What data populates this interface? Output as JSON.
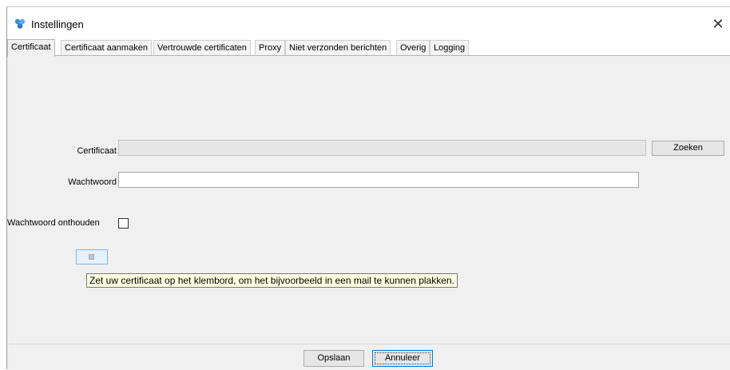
{
  "window": {
    "title": "Instellingen",
    "close_glyph": "✕"
  },
  "tabs": [
    {
      "label": "Certificaat",
      "active": true
    },
    {
      "label": "Certificaat aanmaken",
      "active": false
    },
    {
      "label": "Vertrouwde certificaten",
      "active": false
    },
    {
      "label": "Proxy",
      "active": false
    },
    {
      "label": "Niet verzonden berichten",
      "active": false
    },
    {
      "label": "Overig",
      "active": false
    },
    {
      "label": "Logging",
      "active": false
    }
  ],
  "form": {
    "certificate_label": "Certificaat",
    "certificate_value": "",
    "search_button": "Zoeken",
    "password_label": "Wachtwoord",
    "password_value": "",
    "remember_label": "Wachtwoord onthouden",
    "remember_checked": false
  },
  "tooltip": {
    "text": "Zet uw certificaat op het klembord, om het bijvoorbeeld in een mail te kunnen plakken."
  },
  "footer": {
    "save_button": "Opslaan",
    "cancel_button": "Annuleer"
  },
  "colors": {
    "app_icon": "#3a8fd6",
    "content_bg": "#f0f0f0",
    "tooltip_bg": "#ffffe1",
    "focus_border": "#0078d7"
  },
  "icons": {
    "app": "settings-app-icon",
    "close": "close-icon",
    "copy": "copy-to-clipboard-icon"
  }
}
